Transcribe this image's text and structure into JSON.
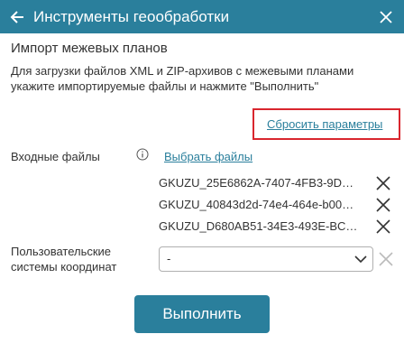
{
  "header": {
    "title": "Инструменты геообработки",
    "back_icon": "arrow-left-icon",
    "close_icon": "close-icon"
  },
  "section": {
    "title": "Импорт межевых планов",
    "description": "Для загрузки файлов XML и ZIP-архивов с межевыми планами укажите импортируемые файлы и нажмите \"Выполнить\""
  },
  "reset_link": "Сбросить параметры",
  "input_files": {
    "label": "Входные файлы",
    "info_icon": "info-icon",
    "select_link": "Выбрать файлы",
    "files": [
      "GKUZU_25E6862A-7407-4FB3-9D…",
      "GKUZU_40843d2d-74e4-464e-b00…",
      "GKUZU_D680AB51-34E3-493E-BC…"
    ],
    "remove_icon": "close-icon"
  },
  "crs": {
    "label": "Пользовательские системы координат",
    "value": "-",
    "chevron_icon": "chevron-down-icon",
    "clear_icon": "close-icon"
  },
  "run_button": "Выполнить",
  "colors": {
    "accent": "#2a7f9c",
    "highlight": "#d9262e"
  }
}
